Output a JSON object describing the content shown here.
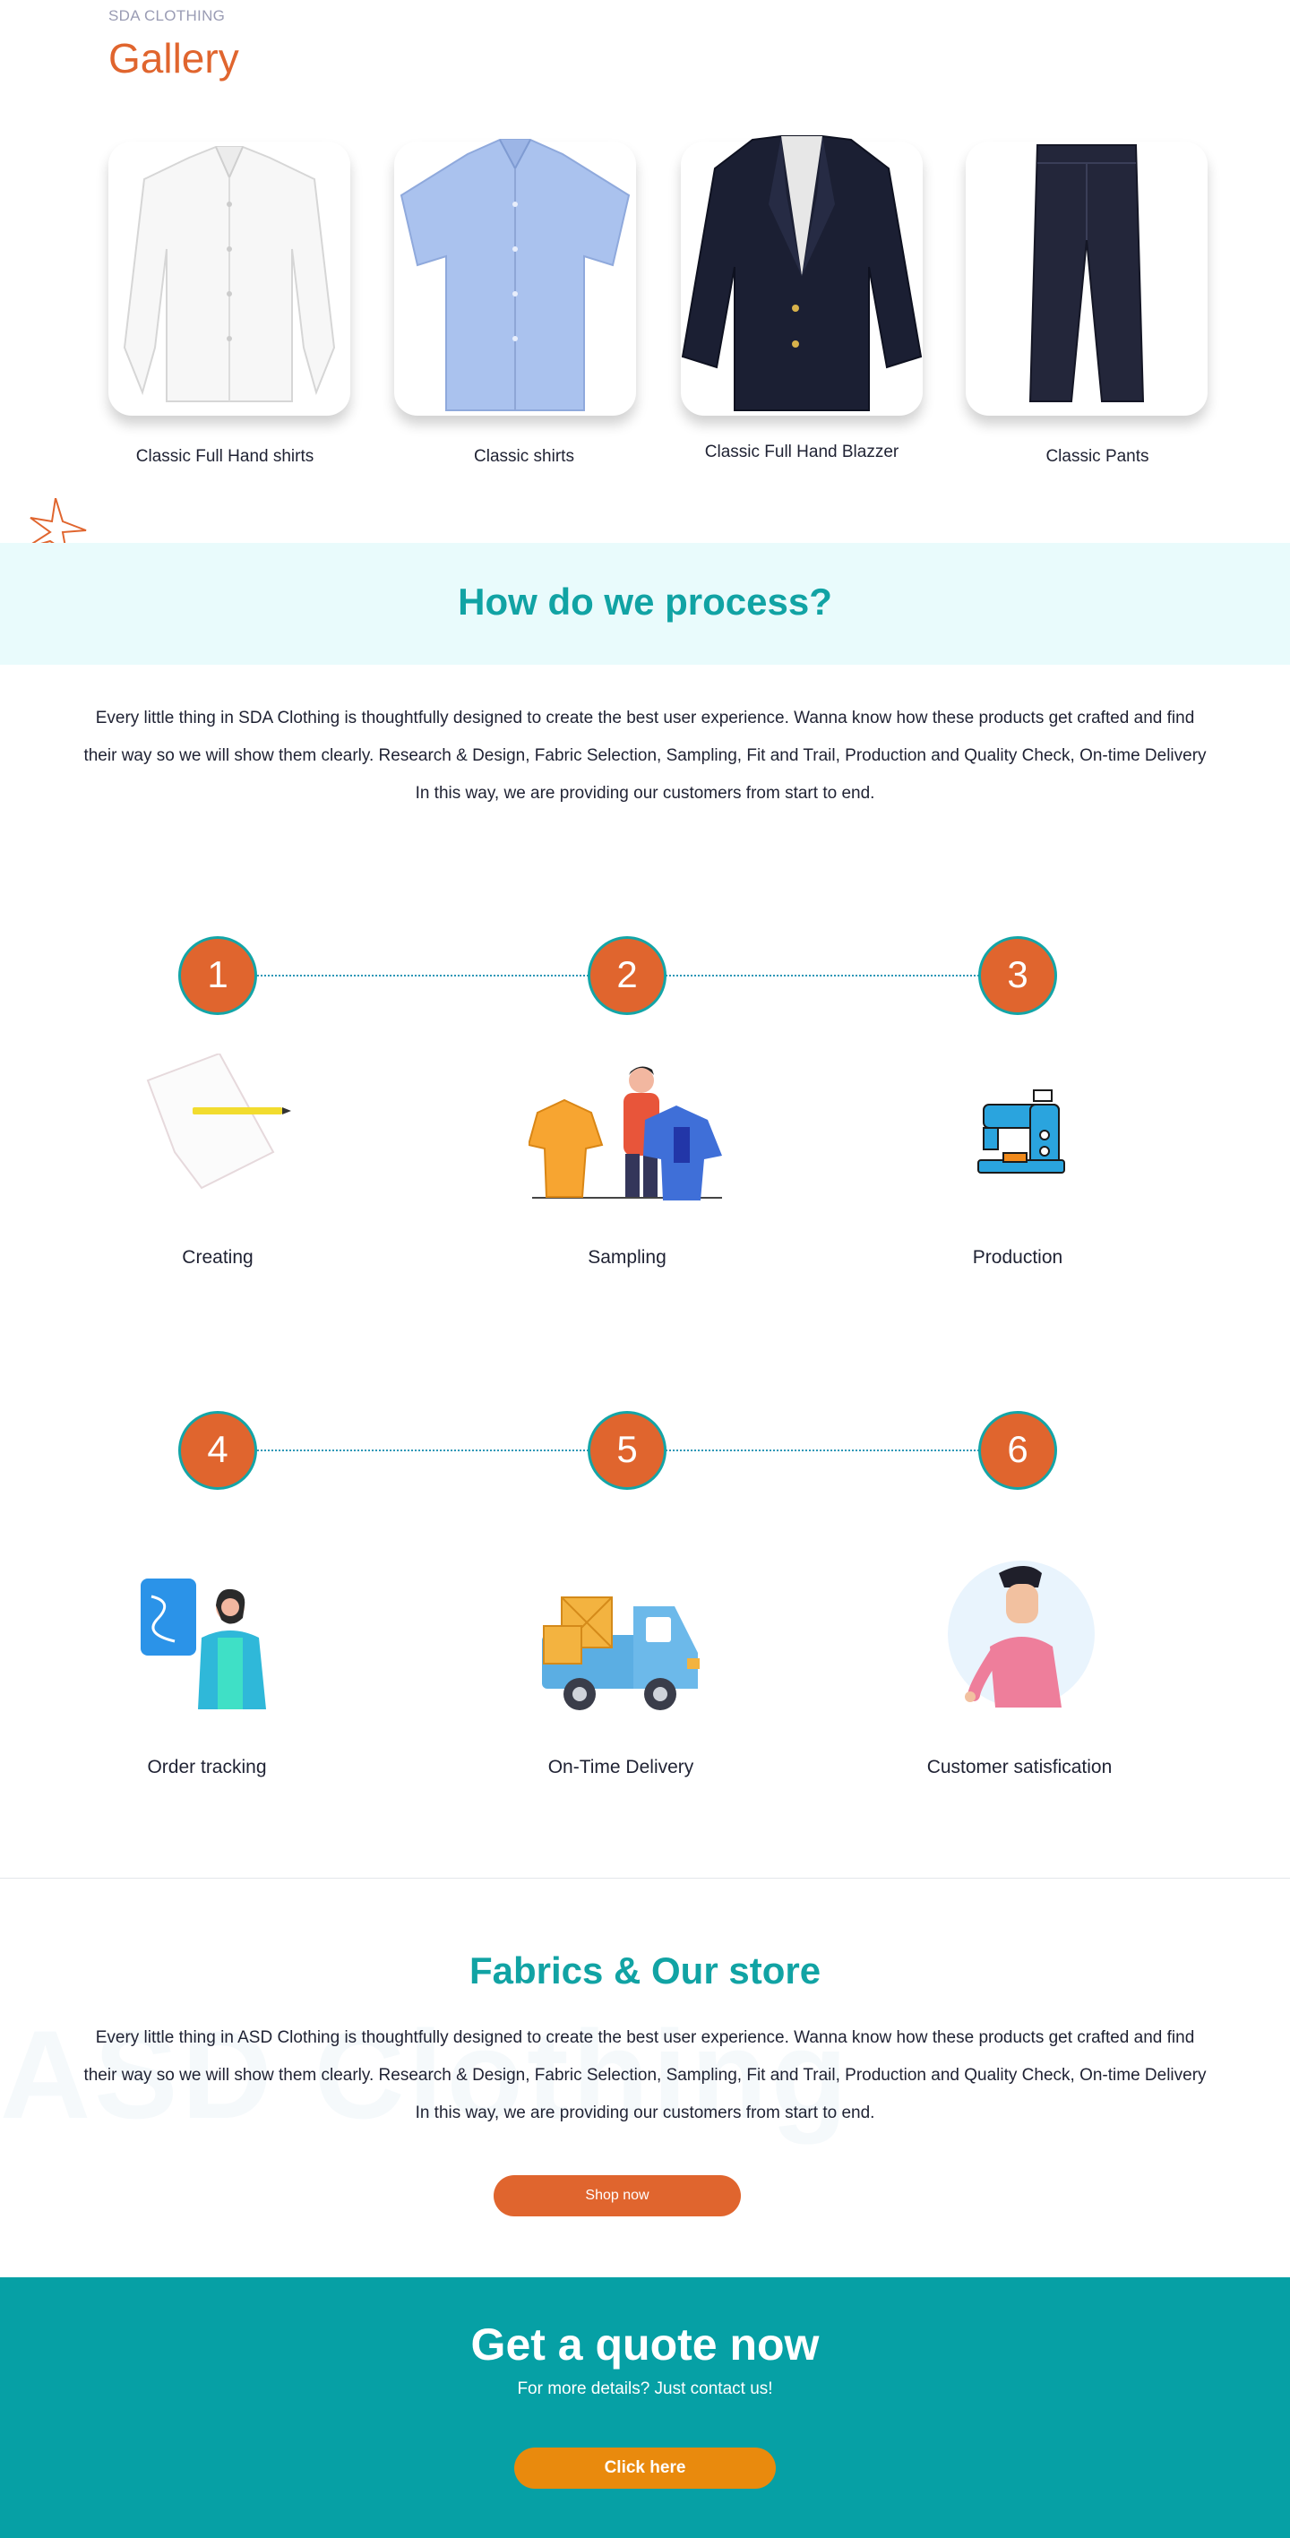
{
  "gallery": {
    "eyebrow": "SDA CLOTHING",
    "title": "Gallery",
    "items": [
      {
        "label": "Classic Full Hand shirts",
        "icon": "white-shirt-image"
      },
      {
        "label": "Classic shirts",
        "icon": "blue-shirt-image"
      },
      {
        "label": "Classic Full Hand Blazzer",
        "icon": "blazer-image"
      },
      {
        "label": "Classic Pants",
        "icon": "pants-image"
      }
    ]
  },
  "process": {
    "title": "How do we process?",
    "description": "Every little thing in SDA Clothing is thoughtfully designed to create the best user experience. Wanna know how these products get crafted and find their way so we will show them clearly. Research & Design, Fabric Selection, Sampling, Fit and Trail, Production and Quality Check, On-time Delivery In this way, we are providing our customers from start to end.",
    "steps": [
      {
        "number": "1",
        "label": "Creating",
        "icon": "paper-pencil-icon"
      },
      {
        "number": "2",
        "label": "Sampling",
        "icon": "clothes-sampling-icon"
      },
      {
        "number": "3",
        "label": "Production",
        "icon": "sewing-machine-icon"
      },
      {
        "number": "4",
        "label": "Order tracking",
        "icon": "order-tracking-icon"
      },
      {
        "number": "5",
        "label": "On-Time Delivery",
        "icon": "delivery-truck-icon"
      },
      {
        "number": "6",
        "label": "Customer satisfication",
        "icon": "customer-icon"
      }
    ]
  },
  "fabrics": {
    "title": "Fabrics & Our store",
    "watermark": "ASD Clothing",
    "description": "Every little thing in ASD Clothing is thoughtfully designed to create the best user experience. Wanna know how these products get crafted and find their way so we will show them clearly. Research & Design, Fabric Selection, Sampling, Fit and Trail, Production and Quality Check, On-time Delivery In this way, we are providing our customers from start to end.",
    "button_label": "Shop now"
  },
  "quote": {
    "title": "Get a quote now",
    "subtitle": "For more details? Just contact us!",
    "button_label": "Click here"
  },
  "colors": {
    "accent_orange": "#e0652e",
    "teal": "#11a3a4",
    "quote_background": "#06a0a5",
    "quote_button": "#e98a0d"
  }
}
